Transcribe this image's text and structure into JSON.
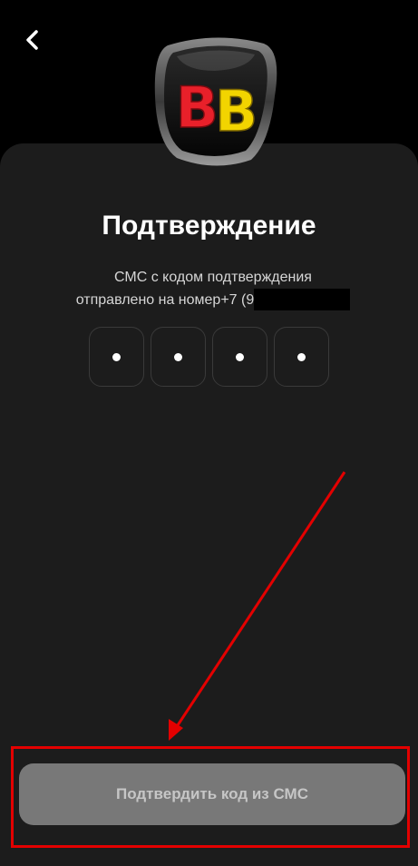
{
  "header": {
    "back_icon": "chevron-left-icon",
    "logo_text": "BB"
  },
  "main": {
    "title": "Подтверждение",
    "subtitle_line1": "СМС с кодом подтверждения",
    "subtitle_line2": "отправлено на номер+7 (9"
  },
  "code_input": {
    "digits": [
      "•",
      "•",
      "•",
      "•"
    ]
  },
  "actions": {
    "confirm_label": "Подтвердить код из СМС"
  },
  "colors": {
    "background": "#000000",
    "panel": "#1c1c1c",
    "button": "#787878",
    "annotation": "#e30000",
    "logo_red": "#e8202a",
    "logo_yellow": "#f2d400"
  }
}
